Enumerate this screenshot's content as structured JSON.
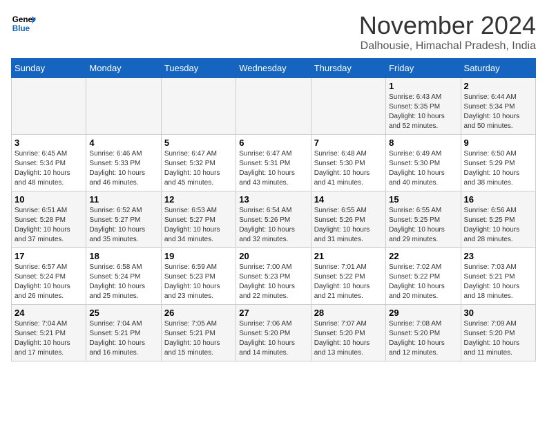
{
  "header": {
    "logo_line1": "General",
    "logo_line2": "Blue",
    "month": "November 2024",
    "location": "Dalhousie, Himachal Pradesh, India"
  },
  "weekdays": [
    "Sunday",
    "Monday",
    "Tuesday",
    "Wednesday",
    "Thursday",
    "Friday",
    "Saturday"
  ],
  "weeks": [
    [
      {
        "day": "",
        "info": ""
      },
      {
        "day": "",
        "info": ""
      },
      {
        "day": "",
        "info": ""
      },
      {
        "day": "",
        "info": ""
      },
      {
        "day": "",
        "info": ""
      },
      {
        "day": "1",
        "info": "Sunrise: 6:43 AM\nSunset: 5:35 PM\nDaylight: 10 hours\nand 52 minutes."
      },
      {
        "day": "2",
        "info": "Sunrise: 6:44 AM\nSunset: 5:34 PM\nDaylight: 10 hours\nand 50 minutes."
      }
    ],
    [
      {
        "day": "3",
        "info": "Sunrise: 6:45 AM\nSunset: 5:34 PM\nDaylight: 10 hours\nand 48 minutes."
      },
      {
        "day": "4",
        "info": "Sunrise: 6:46 AM\nSunset: 5:33 PM\nDaylight: 10 hours\nand 46 minutes."
      },
      {
        "day": "5",
        "info": "Sunrise: 6:47 AM\nSunset: 5:32 PM\nDaylight: 10 hours\nand 45 minutes."
      },
      {
        "day": "6",
        "info": "Sunrise: 6:47 AM\nSunset: 5:31 PM\nDaylight: 10 hours\nand 43 minutes."
      },
      {
        "day": "7",
        "info": "Sunrise: 6:48 AM\nSunset: 5:30 PM\nDaylight: 10 hours\nand 41 minutes."
      },
      {
        "day": "8",
        "info": "Sunrise: 6:49 AM\nSunset: 5:30 PM\nDaylight: 10 hours\nand 40 minutes."
      },
      {
        "day": "9",
        "info": "Sunrise: 6:50 AM\nSunset: 5:29 PM\nDaylight: 10 hours\nand 38 minutes."
      }
    ],
    [
      {
        "day": "10",
        "info": "Sunrise: 6:51 AM\nSunset: 5:28 PM\nDaylight: 10 hours\nand 37 minutes."
      },
      {
        "day": "11",
        "info": "Sunrise: 6:52 AM\nSunset: 5:27 PM\nDaylight: 10 hours\nand 35 minutes."
      },
      {
        "day": "12",
        "info": "Sunrise: 6:53 AM\nSunset: 5:27 PM\nDaylight: 10 hours\nand 34 minutes."
      },
      {
        "day": "13",
        "info": "Sunrise: 6:54 AM\nSunset: 5:26 PM\nDaylight: 10 hours\nand 32 minutes."
      },
      {
        "day": "14",
        "info": "Sunrise: 6:55 AM\nSunset: 5:26 PM\nDaylight: 10 hours\nand 31 minutes."
      },
      {
        "day": "15",
        "info": "Sunrise: 6:55 AM\nSunset: 5:25 PM\nDaylight: 10 hours\nand 29 minutes."
      },
      {
        "day": "16",
        "info": "Sunrise: 6:56 AM\nSunset: 5:25 PM\nDaylight: 10 hours\nand 28 minutes."
      }
    ],
    [
      {
        "day": "17",
        "info": "Sunrise: 6:57 AM\nSunset: 5:24 PM\nDaylight: 10 hours\nand 26 minutes."
      },
      {
        "day": "18",
        "info": "Sunrise: 6:58 AM\nSunset: 5:24 PM\nDaylight: 10 hours\nand 25 minutes."
      },
      {
        "day": "19",
        "info": "Sunrise: 6:59 AM\nSunset: 5:23 PM\nDaylight: 10 hours\nand 23 minutes."
      },
      {
        "day": "20",
        "info": "Sunrise: 7:00 AM\nSunset: 5:23 PM\nDaylight: 10 hours\nand 22 minutes."
      },
      {
        "day": "21",
        "info": "Sunrise: 7:01 AM\nSunset: 5:22 PM\nDaylight: 10 hours\nand 21 minutes."
      },
      {
        "day": "22",
        "info": "Sunrise: 7:02 AM\nSunset: 5:22 PM\nDaylight: 10 hours\nand 20 minutes."
      },
      {
        "day": "23",
        "info": "Sunrise: 7:03 AM\nSunset: 5:21 PM\nDaylight: 10 hours\nand 18 minutes."
      }
    ],
    [
      {
        "day": "24",
        "info": "Sunrise: 7:04 AM\nSunset: 5:21 PM\nDaylight: 10 hours\nand 17 minutes."
      },
      {
        "day": "25",
        "info": "Sunrise: 7:04 AM\nSunset: 5:21 PM\nDaylight: 10 hours\nand 16 minutes."
      },
      {
        "day": "26",
        "info": "Sunrise: 7:05 AM\nSunset: 5:21 PM\nDaylight: 10 hours\nand 15 minutes."
      },
      {
        "day": "27",
        "info": "Sunrise: 7:06 AM\nSunset: 5:20 PM\nDaylight: 10 hours\nand 14 minutes."
      },
      {
        "day": "28",
        "info": "Sunrise: 7:07 AM\nSunset: 5:20 PM\nDaylight: 10 hours\nand 13 minutes."
      },
      {
        "day": "29",
        "info": "Sunrise: 7:08 AM\nSunset: 5:20 PM\nDaylight: 10 hours\nand 12 minutes."
      },
      {
        "day": "30",
        "info": "Sunrise: 7:09 AM\nSunset: 5:20 PM\nDaylight: 10 hours\nand 11 minutes."
      }
    ]
  ]
}
